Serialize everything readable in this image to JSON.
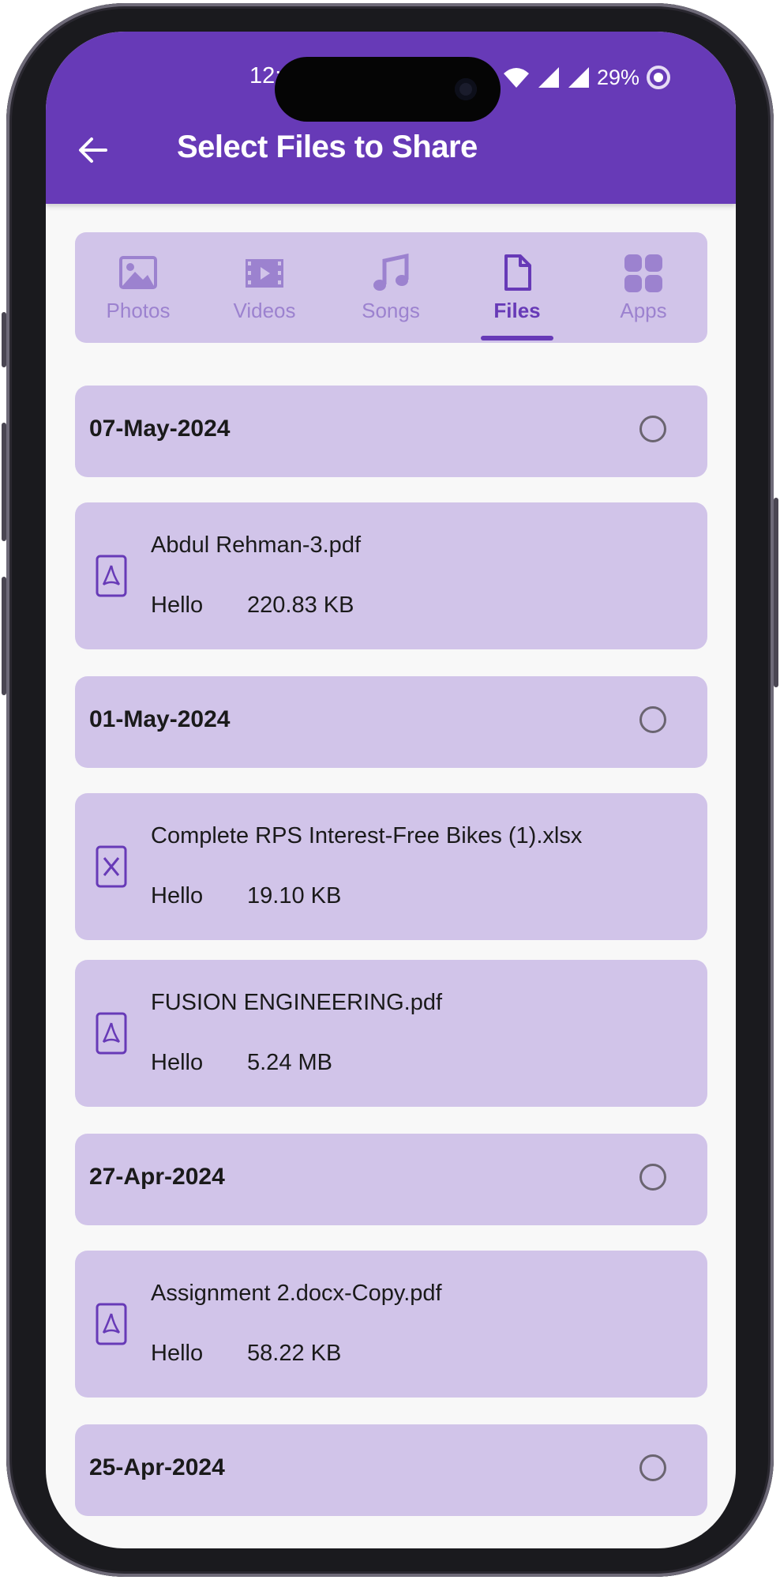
{
  "status_bar": {
    "time": "12:",
    "battery": "29%"
  },
  "header": {
    "title": "Select Files to Share"
  },
  "tabs": [
    {
      "label": "Photos",
      "icon": "image-icon",
      "active": false
    },
    {
      "label": "Videos",
      "icon": "film-icon",
      "active": false
    },
    {
      "label": "Songs",
      "icon": "music-note-icon",
      "active": false
    },
    {
      "label": "Files",
      "icon": "file-icon",
      "active": true
    },
    {
      "label": "Apps",
      "icon": "apps-grid-icon",
      "active": false
    }
  ],
  "groups": [
    {
      "date": "07-May-2024",
      "files": [
        {
          "name": "Abdul Rehman-3.pdf",
          "label": "Hello",
          "size": "220.83 KB",
          "type": "pdf"
        }
      ]
    },
    {
      "date": "01-May-2024",
      "files": [
        {
          "name": "Complete RPS Interest-Free Bikes (1).xlsx",
          "label": "Hello",
          "size": "19.10 KB",
          "type": "xlsx"
        },
        {
          "name": "FUSION ENGINEERING.pdf",
          "label": "Hello",
          "size": "5.24 MB",
          "type": "pdf"
        }
      ]
    },
    {
      "date": "27-Apr-2024",
      "files": [
        {
          "name": "Assignment 2.docx-Copy.pdf",
          "label": "Hello",
          "size": "58.22 KB",
          "type": "pdf"
        }
      ]
    },
    {
      "date": "25-Apr-2024",
      "files": []
    }
  ],
  "colors": {
    "primary": "#673ab7",
    "card": "#d1c4e9",
    "tab_inactive": "#9c82cf",
    "background": "#f8f8f8"
  }
}
